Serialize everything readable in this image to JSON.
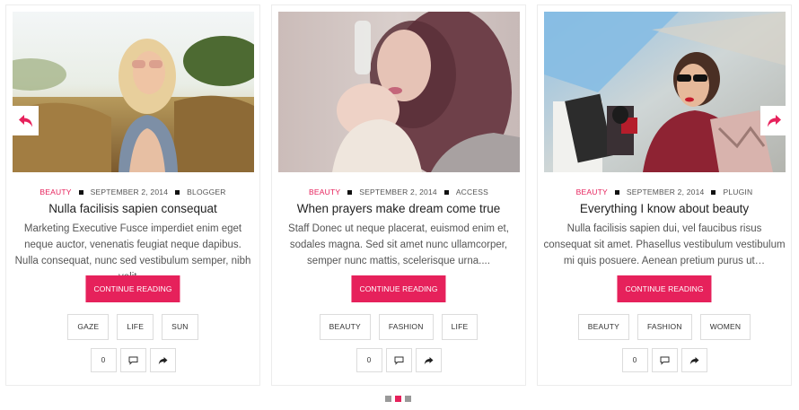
{
  "slider": {
    "prev_icon": "reply-arrow-icon",
    "next_icon": "share-arrow-icon",
    "dots": [
      false,
      true,
      false
    ]
  },
  "accent_color": "#e6215b",
  "posts": [
    {
      "image": "woman-in-wheat-field",
      "category": "BEAUTY",
      "date": "SEPTEMBER 2, 2014",
      "tag_meta": "BLOGGER",
      "title": "Nulla facilisis sapien consequat",
      "excerpt": "Marketing Executive Fusce imperdiet enim eget neque auctor, venenatis feugiat neque dapibus. Nulla consequat, nunc sed vestibulum semper, nibh velit…",
      "button": "CONTINUE READING",
      "tags": [
        "GAZE",
        "LIFE",
        "SUN"
      ],
      "likes": "0"
    },
    {
      "image": "woman-with-glass-bottle",
      "category": "BEAUTY",
      "date": "SEPTEMBER 2, 2014",
      "tag_meta": "ACCESS",
      "title": "When prayers make dream come true",
      "excerpt": "Staff Donec ut neque placerat, euismod enim et, sodales magna. Sed sit amet nunc ullamcorper, semper nunc mattis, scelerisque urna....",
      "button": "CONTINUE READING",
      "tags": [
        "BEAUTY",
        "FASHION",
        "LIFE"
      ],
      "likes": "0"
    },
    {
      "image": "woman-with-shopping-bags",
      "category": "BEAUTY",
      "date": "SEPTEMBER 2, 2014",
      "tag_meta": "PLUGIN",
      "title": "Everything I know about beauty",
      "excerpt": "Nulla facilisis sapien dui, vel faucibus risus consequat sit amet. Phasellus vestibulum vestibulum mi quis posuere. Aenean pretium purus ut…",
      "button": "CONTINUE READING",
      "tags": [
        "BEAUTY",
        "FASHION",
        "WOMEN"
      ],
      "likes": "0"
    }
  ]
}
